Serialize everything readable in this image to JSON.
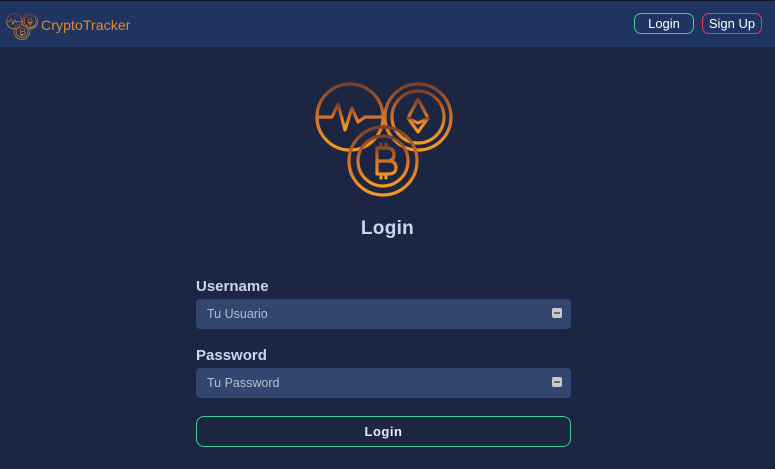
{
  "header": {
    "brand_name": "CryptoTracker",
    "brand_logo_icon": "crypto-coins-icon",
    "login_label": "Login",
    "signup_label": "Sign Up"
  },
  "main": {
    "logo_icon": "crypto-coins-icon",
    "title": "Login",
    "username": {
      "label": "Username",
      "placeholder": "Tu Usuario",
      "value": "",
      "icon": "password-manager-key-icon"
    },
    "password": {
      "label": "Password",
      "placeholder": "Tu Password",
      "value": "",
      "icon": "password-manager-key-icon"
    },
    "submit_label": "Login"
  },
  "colors": {
    "background": "#1c2541",
    "topbar": "#1f3460",
    "accent_orange": "#e08a2a",
    "login_border": "#3ccf8e",
    "signup_border": "#e8405a",
    "input_bg": "#33466f",
    "label_text": "#c9d6f2"
  }
}
